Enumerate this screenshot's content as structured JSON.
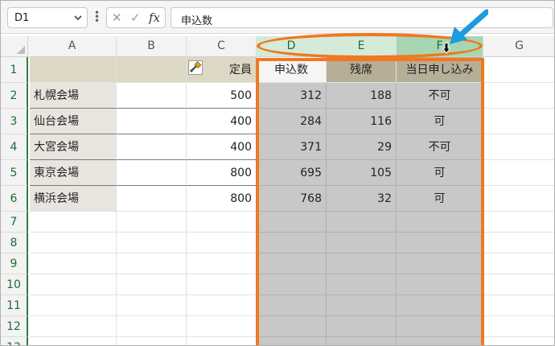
{
  "formula_bar": {
    "name_box": "D1",
    "cancel_glyph": "✕",
    "enter_glyph": "✓",
    "fx_label": "fx",
    "formula": "申込数"
  },
  "columns": [
    "A",
    "B",
    "C",
    "D",
    "E",
    "F",
    "G"
  ],
  "row_numbers": [
    "1",
    "2",
    "3",
    "4",
    "5",
    "6",
    "7",
    "8",
    "9",
    "10",
    "11",
    "12",
    "13"
  ],
  "header_row": {
    "c": "定員",
    "d": "申込数",
    "e": "残席",
    "f": "当日申し込み"
  },
  "rows": [
    {
      "a": "札幌会場",
      "c": "500",
      "d": "312",
      "e": "188",
      "f": "不可"
    },
    {
      "a": "仙台会場",
      "c": "400",
      "d": "284",
      "e": "116",
      "f": "可"
    },
    {
      "a": "大宮会場",
      "c": "400",
      "d": "371",
      "e": "29",
      "f": "不可"
    },
    {
      "a": "東京会場",
      "c": "800",
      "d": "695",
      "e": "105",
      "f": "可"
    },
    {
      "a": "横浜会場",
      "c": "800",
      "d": "768",
      "e": "32",
      "f": "可"
    }
  ],
  "icons": {
    "dropdown": "chevron-down-icon",
    "format_painter": "paintbrush-icon",
    "cursor": "down-arrow-cursor-icon",
    "callout": "blue-arrow-icon"
  },
  "colors": {
    "highlight": "#f07820",
    "selection_gray": "#c8c8c8",
    "callout_blue": "#1e9be0",
    "row_header_green": "#1e6b35"
  }
}
